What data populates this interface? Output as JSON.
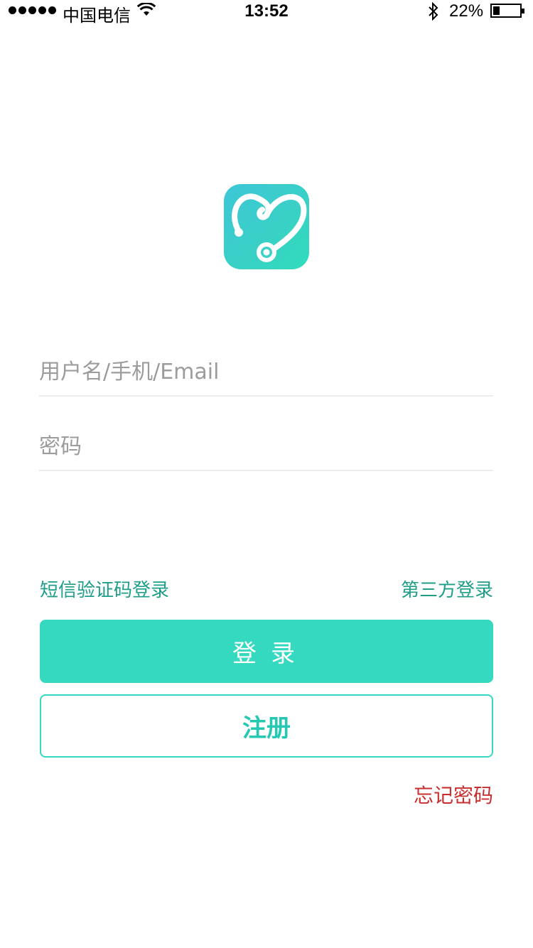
{
  "status_bar": {
    "carrier": "中国电信",
    "time": "13:52",
    "battery": "22%",
    "battery_level": 0.22,
    "icons": [
      "signal-dots",
      "wifi-icon",
      "bluetooth-icon",
      "battery-icon"
    ]
  },
  "logo": {
    "icon": "stethoscope-heart-icon",
    "gradient": [
      "#3dc6d7",
      "#30dcbc"
    ]
  },
  "form": {
    "username_placeholder": "用户名/手机/Email",
    "username_value": "",
    "password_placeholder": "密码",
    "password_value": ""
  },
  "links": {
    "sms_login": "短信验证码登录",
    "third_party_login": "第三方登录",
    "forgot_password": "忘记密码"
  },
  "buttons": {
    "login": "登录",
    "register": "注册"
  },
  "colors": {
    "primary": "#35d9bf",
    "link": "#1f9d88",
    "danger": "#c8302f"
  }
}
